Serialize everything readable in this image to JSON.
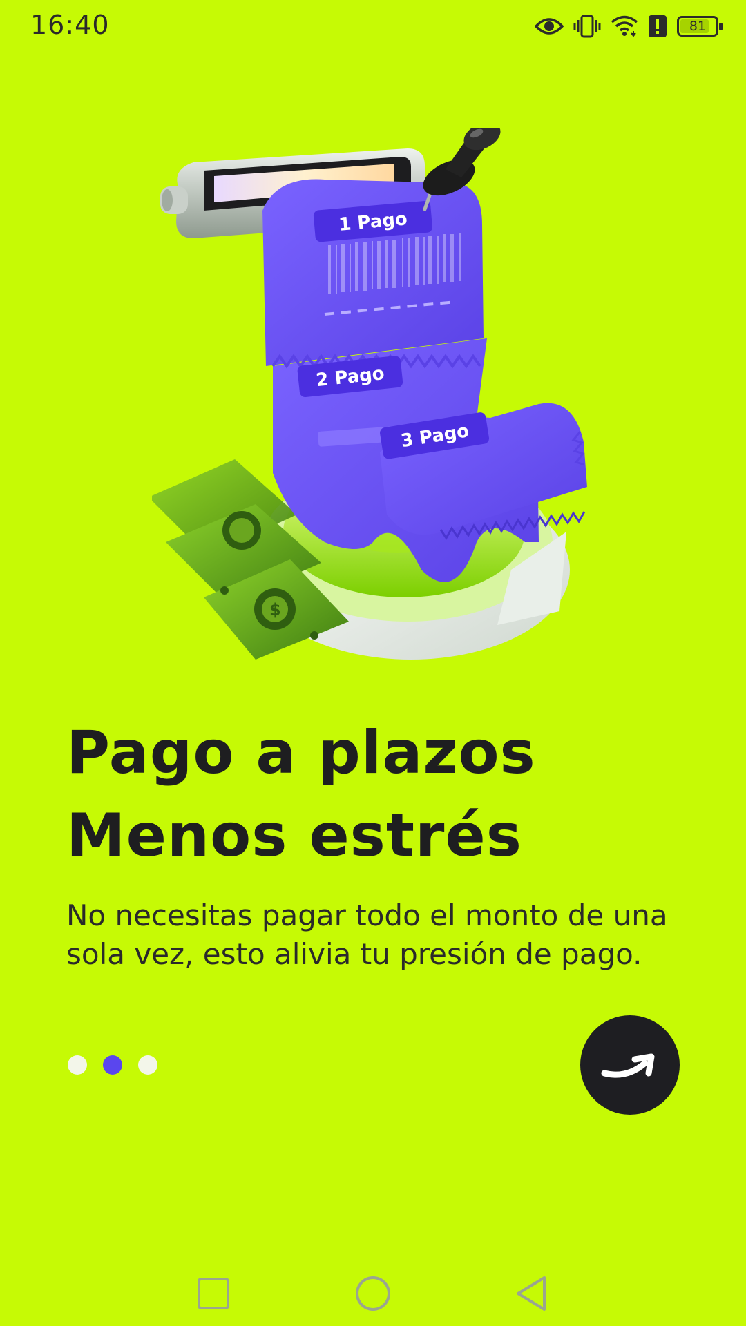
{
  "status_bar": {
    "time": "16:40",
    "battery_level": "81",
    "battery_fraction": 0.81,
    "icons": [
      "eye-icon",
      "vibrate-icon",
      "wifi-icon",
      "alert-icon",
      "battery-icon"
    ]
  },
  "illustration": {
    "ticket_labels": [
      "1 Pago",
      "2 Pago",
      "3 Pago"
    ]
  },
  "onboarding": {
    "headline_line1": "Pago a plazos",
    "headline_line2": "Menos estrés",
    "description": "No necesitas pagar todo el monto de una sola vez, esto alivia tu presión de pago.",
    "page_count": 3,
    "current_page": 2
  },
  "colors": {
    "background": "#c6fa05",
    "accent": "#5a46ee",
    "button": "#1e1e22",
    "text": "#1f1f22"
  },
  "nav_bar": {
    "icons": [
      "recent-apps-icon",
      "home-icon",
      "back-icon"
    ]
  }
}
